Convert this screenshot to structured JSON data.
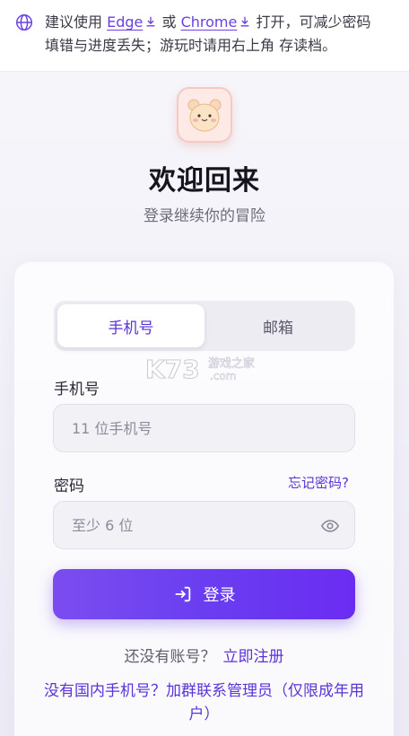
{
  "notice": {
    "prefix": "建议使用",
    "edge": "Edge",
    "or": "或",
    "chrome": "Chrome",
    "suffix_line1": "打开，可减少密码",
    "line2": "填错与进度丢失；游玩时请用右上角 存读档。"
  },
  "header": {
    "title": "欢迎回来",
    "subtitle": "登录继续你的冒险"
  },
  "tabs": [
    {
      "label": "手机号",
      "active": true
    },
    {
      "label": "邮箱",
      "active": false
    }
  ],
  "form": {
    "phone_label": "手机号",
    "phone_placeholder": "11 位手机号",
    "password_label": "密码",
    "forgot_label": "忘记密码?",
    "password_placeholder": "至少 6 位",
    "login_label": "登录"
  },
  "footer": {
    "no_account": "还没有账号？",
    "register": "立即注册",
    "contact": "没有国内手机号？加群联系管理员（仅限成年用户）"
  },
  "watermark": {
    "brand": "K73",
    "site": "游戏之家",
    "domain": ".com"
  },
  "colors": {
    "accent": "#5b33d6",
    "button_start": "#7b4df0",
    "button_end": "#6b2cf2"
  },
  "icons": [
    "globe-icon",
    "download-icon",
    "eye-icon",
    "login-icon",
    "bear-logo-icon"
  ]
}
